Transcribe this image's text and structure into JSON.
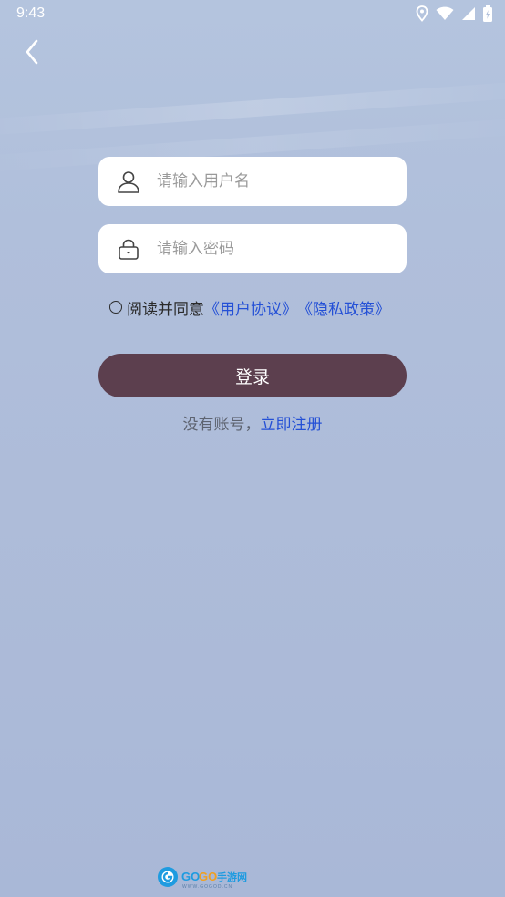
{
  "status_bar": {
    "time": "9:43",
    "icons": [
      "location-icon",
      "wifi-icon",
      "signal-icon",
      "battery-charging-icon"
    ]
  },
  "nav": {
    "back_icon": "chevron-left-icon"
  },
  "form": {
    "username": {
      "placeholder": "请输入用户名",
      "value": "",
      "icon": "user-icon"
    },
    "password": {
      "placeholder": "请输入密码",
      "value": "",
      "icon": "lock-icon"
    },
    "agreement": {
      "checked": false,
      "prefix": "阅读并同意",
      "user_agreement": "《用户协议》",
      "privacy_policy": "《隐私政策》"
    },
    "login_label": "登录",
    "register_prompt": "没有账号，",
    "register_link": "立即注册"
  },
  "colors": {
    "primary_button": "#5c3f4e",
    "link": "#2450d6",
    "background": "#aebcd9"
  },
  "watermark": {
    "text": "GOGO手游网",
    "sub": "WWW.GOGOD.CN"
  }
}
